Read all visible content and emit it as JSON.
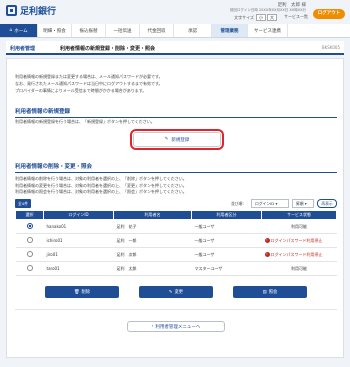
{
  "header": {
    "bank_name": "足利銀行",
    "user_name": "足利　太郎 様",
    "last_login": "前回ログイン日時 20XX年XX月XX日 XX時XX分",
    "font_size_label": "文字サイズ",
    "font_small": "小",
    "font_large": "大",
    "service_link": "サービス一覧",
    "logout_label": "ログアウト"
  },
  "nav": {
    "items": [
      "ホーム",
      "明細・照会",
      "振込振替",
      "一括伝送",
      "代金回収",
      "承認",
      "管理業務",
      "サービス連携"
    ],
    "active_index": 6
  },
  "page": {
    "category": "利用者管理",
    "title": "利用者情報の新規登録・削除・変更・照会",
    "screen_code": "BKSK005"
  },
  "intro": [
    "利用者情報の新規登録または変更する場合は、メール通知パスワードが必要です。",
    "なお、発行されたメール通知パスワードは当日中にログアウトするまで有効です。",
    "プロバイダーの事情によりメール受信まで時間がかかる場合があります。"
  ],
  "new_section": {
    "heading": "利用者情報の新規登録",
    "desc": "利用者情報の新規登録を行う場合は、「新規登録」ボタンを押してください。",
    "button": "新規登録"
  },
  "list_section": {
    "heading": "利用者情報の削除・変更・照会",
    "desc": [
      "利用者情報の削除を行う場合は、対象の利用者を選択の上、「削除」ボタンを押してください。",
      "利用者情報の変更を行う場合は、対象の利用者を選択の上、「変更」ボタンを押してください。",
      "利用者情報の照会を行う場合は、対象の利用者を選択の上、「照会」ボタンを押してください。"
    ]
  },
  "table_bar": {
    "count": "全4件",
    "sort_label": "並び順：",
    "sort_key": "ログインID",
    "sort_order": "昇順",
    "sort_button": "再表示"
  },
  "table": {
    "headers": [
      "選択",
      "ログインID",
      "利用者名",
      "利用者区分",
      "サービス状態"
    ],
    "rows": [
      {
        "selected": true,
        "login_id": "hanako01",
        "name": "足利　花子",
        "type": "一般ユーザ",
        "status": "利用可能",
        "warn": false
      },
      {
        "selected": false,
        "login_id": "ichiro01",
        "name": "足利　一郎",
        "type": "一般ユーザ",
        "status": "ログインパスワード利用停止",
        "warn": true
      },
      {
        "selected": false,
        "login_id": "jiro01",
        "name": "足利　次郎",
        "type": "一般ユーザ",
        "status": "ログインパスワード利用停止",
        "warn": true
      },
      {
        "selected": false,
        "login_id": "taro01",
        "name": "足利　太郎",
        "type": "マスターユーザ",
        "status": "利用可能",
        "warn": false
      }
    ]
  },
  "actions": {
    "delete": "削除",
    "edit": "変更",
    "view": "照会"
  },
  "back_button": "利用者管理メニューへ",
  "colors": {
    "primary": "#1f4e96",
    "accent": "#f08c00",
    "highlight": "#e0262c"
  }
}
